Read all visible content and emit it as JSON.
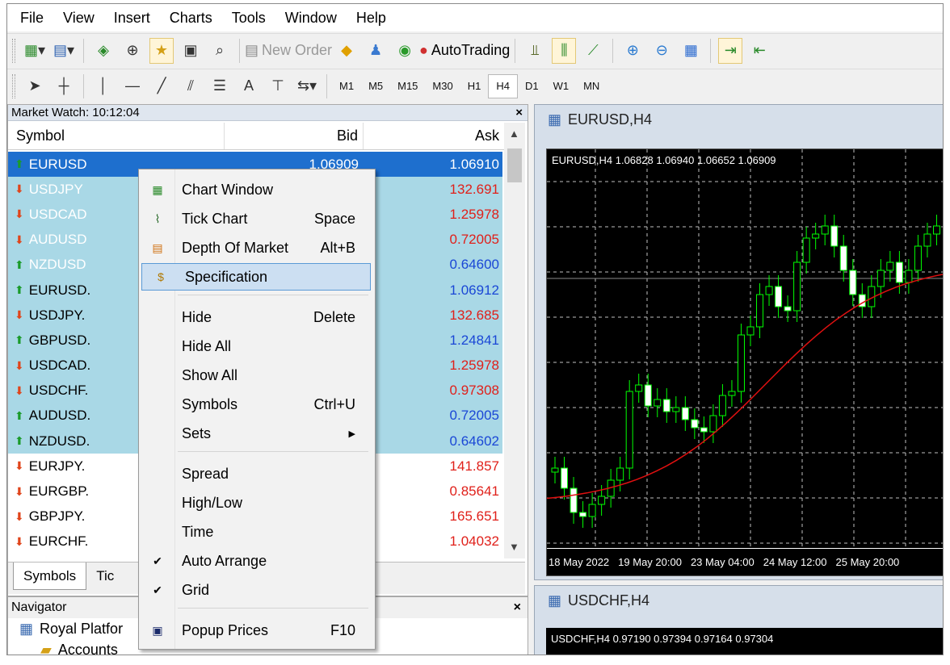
{
  "menubar": [
    "File",
    "View",
    "Insert",
    "Charts",
    "Tools",
    "Window",
    "Help"
  ],
  "toolbar": {
    "new_order": "New Order",
    "autotrading": "AutoTrading"
  },
  "text_tool": "A",
  "timeframes": [
    "M1",
    "M5",
    "M15",
    "M30",
    "H1",
    "H4",
    "D1",
    "W1",
    "MN"
  ],
  "selected_timeframe": "H4",
  "market_watch": {
    "title": "Market Watch: 10:12:04",
    "close": "×",
    "columns": {
      "symbol": "Symbol",
      "bid": "Bid",
      "ask": "Ask"
    },
    "rows": [
      {
        "symbol": "EURUSD",
        "bid": "1.06909",
        "ask": "1.06910",
        "dir": "up"
      },
      {
        "symbol": "USDJPY",
        "bid": "",
        "ask": "132.691",
        "dir": "down"
      },
      {
        "symbol": "USDCAD",
        "bid": "",
        "ask": "1.25978",
        "dir": "down"
      },
      {
        "symbol": "AUDUSD",
        "bid": "",
        "ask": "0.72005",
        "dir": "down"
      },
      {
        "symbol": "NZDUSD",
        "bid": "",
        "ask": "0.64600",
        "dir": "up"
      },
      {
        "symbol": "EURUSD.",
        "bid": "",
        "ask": "1.06912",
        "dir": "up"
      },
      {
        "symbol": "USDJPY.",
        "bid": "",
        "ask": "132.685",
        "dir": "down"
      },
      {
        "symbol": "GBPUSD.",
        "bid": "",
        "ask": "1.24841",
        "dir": "up"
      },
      {
        "symbol": "USDCAD.",
        "bid": "",
        "ask": "1.25978",
        "dir": "down"
      },
      {
        "symbol": "USDCHF.",
        "bid": "",
        "ask": "0.97308",
        "dir": "down"
      },
      {
        "symbol": "AUDUSD.",
        "bid": "",
        "ask": "0.72005",
        "dir": "up"
      },
      {
        "symbol": "NZDUSD.",
        "bid": "",
        "ask": "0.64602",
        "dir": "up"
      },
      {
        "symbol": "EURJPY.",
        "bid": "",
        "ask": "141.857",
        "dir": "down"
      },
      {
        "symbol": "EURGBP.",
        "bid": "",
        "ask": "0.85641",
        "dir": "down"
      },
      {
        "symbol": "GBPJPY.",
        "bid": "",
        "ask": "165.651",
        "dir": "down"
      },
      {
        "symbol": "EURCHF.",
        "bid": "",
        "ask": "1.04032",
        "dir": "down"
      }
    ],
    "tabs": [
      "Symbols",
      "Tic"
    ]
  },
  "navigator": {
    "title": "Navigator",
    "close": "×",
    "items": [
      "Royal Platfor",
      "Accounts"
    ]
  },
  "context_menu": [
    {
      "label": "Chart Window",
      "shortcut": "",
      "icon": "chart-window-icon"
    },
    {
      "label": "Tick Chart",
      "shortcut": "Space",
      "icon": "tick-chart-icon"
    },
    {
      "label": "Depth Of Market",
      "shortcut": "Alt+B",
      "icon": "depth-of-market-icon"
    },
    {
      "label": "Specification",
      "shortcut": "",
      "icon": "specification-icon"
    },
    {
      "label": "Hide",
      "shortcut": "Delete"
    },
    {
      "label": "Hide All",
      "shortcut": ""
    },
    {
      "label": "Show All",
      "shortcut": ""
    },
    {
      "label": "Symbols",
      "shortcut": "Ctrl+U"
    },
    {
      "label": "Sets",
      "shortcut": "",
      "submenu": true
    },
    {
      "label": "Spread",
      "shortcut": ""
    },
    {
      "label": "High/Low",
      "shortcut": ""
    },
    {
      "label": "Time",
      "shortcut": ""
    },
    {
      "label": "Auto Arrange",
      "shortcut": "",
      "checked": true
    },
    {
      "label": "Grid",
      "shortcut": "",
      "checked": true
    },
    {
      "label": "Popup Prices",
      "shortcut": "F10",
      "icon": "popup-prices-icon"
    }
  ],
  "chart1": {
    "title": "EURUSD,H4",
    "ohlc": "EURUSD,H4  1.06828 1.06940 1.06652 1.06909",
    "xlabels": [
      "18 May 2022",
      "19 May 20:00",
      "23 May 04:00",
      "24 May 12:00",
      "25 May 20:00"
    ]
  },
  "chart2": {
    "title": "USDCHF,H4",
    "ohlc": "USDCHF,H4  0.97190 0.97394 0.97164 0.97304"
  },
  "colors": {
    "up_arrow": "#1a9b2a",
    "down_arrow": "#e0441a",
    "ask_down": "#e0201a",
    "ask_up": "#1a47d6",
    "candle": "#00ff00",
    "ma_line": "#e01010"
  }
}
